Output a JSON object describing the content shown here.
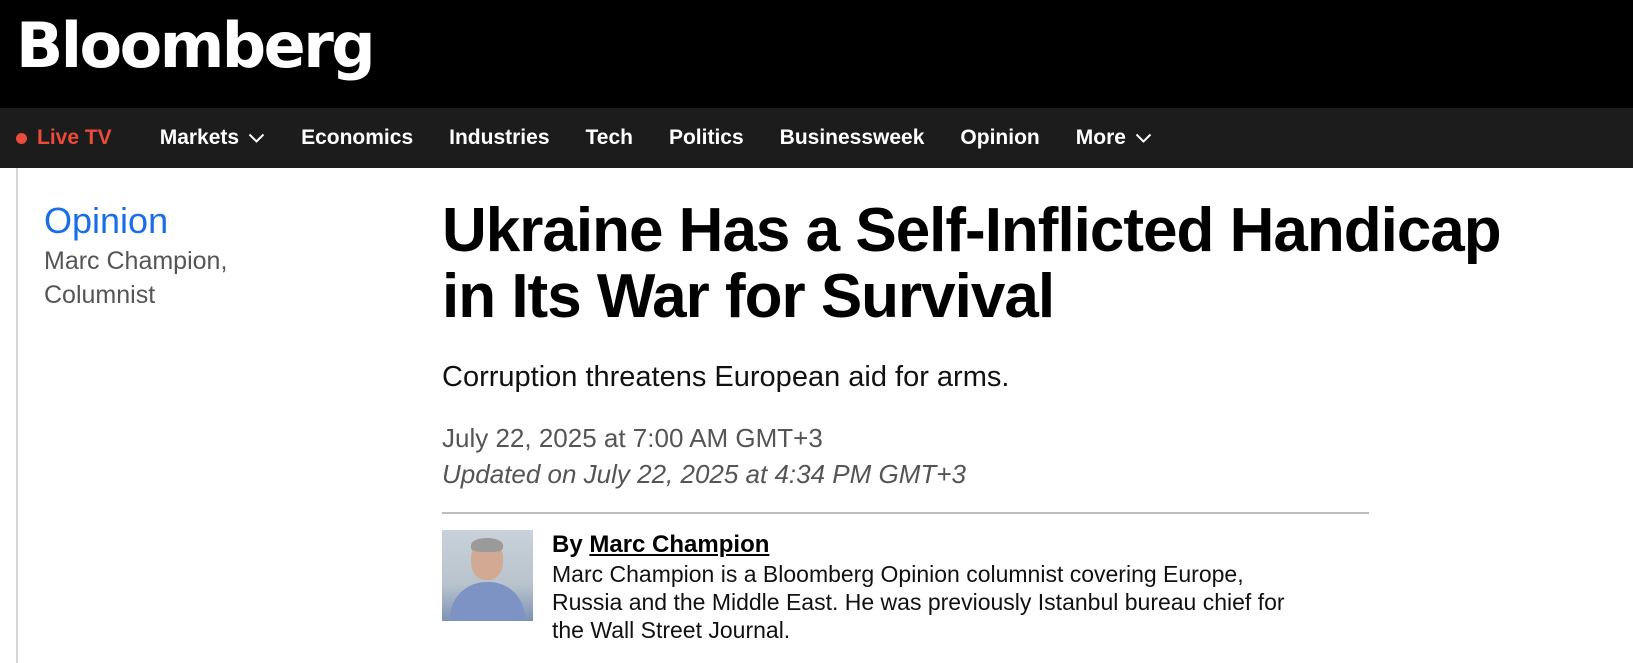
{
  "masthead": {
    "logo": "Bloomberg"
  },
  "nav": {
    "live_label": "Live TV",
    "items": [
      {
        "label": "Markets",
        "has_menu": true
      },
      {
        "label": "Economics",
        "has_menu": false
      },
      {
        "label": "Industries",
        "has_menu": false
      },
      {
        "label": "Tech",
        "has_menu": false
      },
      {
        "label": "Politics",
        "has_menu": false
      },
      {
        "label": "Businessweek",
        "has_menu": false
      },
      {
        "label": "Opinion",
        "has_menu": false
      },
      {
        "label": "More",
        "has_menu": true
      }
    ]
  },
  "sidebar": {
    "section": "Opinion",
    "author_line1": "Marc Champion,",
    "author_line2": "Columnist"
  },
  "article": {
    "headline_line1": "Ukraine Has a Self-Inflicted Handicap",
    "headline_line2": "in Its War for Survival",
    "dek": "Corruption threatens European aid for arms.",
    "published": "July 22, 2025 at 7:00 AM GMT+3",
    "updated": "Updated on July 22, 2025 at 4:34 PM GMT+3",
    "byline_prefix": "By",
    "author_name": "Marc Champion",
    "bio_line1": "Marc Champion is a Bloomberg Opinion columnist covering Europe,",
    "bio_line2": "Russia and the Middle East. He was previously Istanbul bureau chief for",
    "bio_line3": "the Wall Street Journal."
  },
  "colors": {
    "masthead_bg": "#000000",
    "nav_bg": "#1c1c1c",
    "live_red": "#ec4a3a",
    "opinion_blue": "#1a6ee6"
  },
  "icons": [
    "live-dot-icon",
    "chevron-down-icon"
  ]
}
